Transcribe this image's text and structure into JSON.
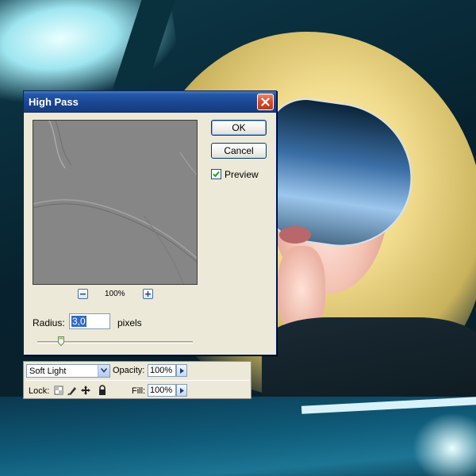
{
  "dialog": {
    "title": "High Pass",
    "ok_label": "OK",
    "cancel_label": "Cancel",
    "preview_label": "Preview",
    "preview_checked": true,
    "zoom_level": "100%",
    "radius_label": "Radius:",
    "radius_value": "3,0",
    "radius_unit": "pixels",
    "close_icon": "close-icon"
  },
  "layers": {
    "blend_mode": "Soft Light",
    "opacity_label": "Opacity:",
    "opacity_value": "100%",
    "lock_label": "Lock:",
    "fill_label": "Fill:",
    "fill_value": "100%"
  },
  "colors": {
    "titlebar": "#1a4591",
    "dialog_bg": "#ece9d8",
    "close_button": "#d3492a",
    "selection": "#316ac5"
  }
}
